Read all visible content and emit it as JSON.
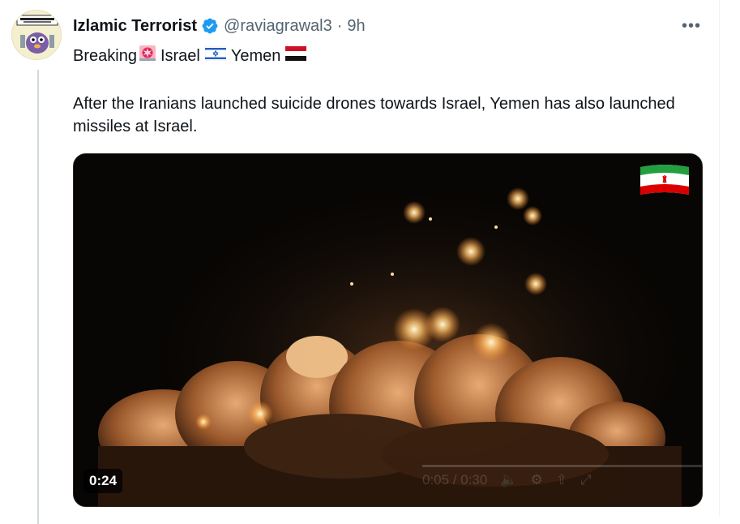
{
  "tweet": {
    "author_name": "Izlamic Terrorist",
    "handle": "@raviagrawal3",
    "separator": "·",
    "time": "9h",
    "more_label": "•••",
    "line1": {
      "breaking": "Breaking",
      "israel": "Israel",
      "yemen": "Yemen"
    },
    "body": "After the Iranians launched suicide drones towards Israel, Yemen has also launched missiles at Israel."
  },
  "video": {
    "duration": "0:24",
    "ghost_time": "0:05 / 0:30"
  },
  "colors": {
    "verified": "#1d9bf0",
    "text": "#0f1419",
    "secondary": "#536471"
  },
  "icons": {
    "verified": "verified-badge-icon",
    "more": "more-options-icon",
    "siren": "siren-emoji-icon",
    "israel_flag": "israel-flag-icon",
    "yemen_flag": "yemen-flag-icon",
    "iran_flag": "iran-flag-icon"
  }
}
